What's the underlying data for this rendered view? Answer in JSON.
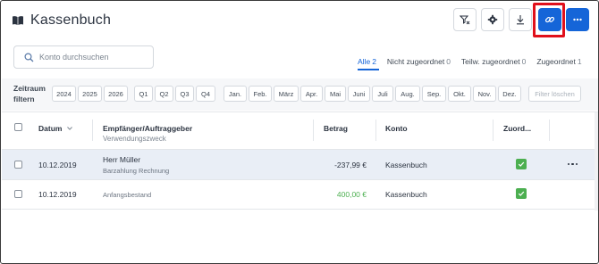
{
  "header": {
    "title": "Kassenbuch"
  },
  "toolbar": {
    "icons": [
      "filter-clear-icon",
      "settings-icon",
      "download-icon",
      "link-icon",
      "more-icon"
    ],
    "accent_color": "#1565d8",
    "highlight_color": "#e0101b"
  },
  "search": {
    "placeholder": "Konto durchsuchen",
    "value": ""
  },
  "tabs": [
    {
      "label": "Alle",
      "count": "2",
      "active": true
    },
    {
      "label": "Nicht zugeordnet",
      "count": "0",
      "active": false
    },
    {
      "label": "Teilw. zugeordnet",
      "count": "0",
      "active": false
    },
    {
      "label": "Zugeordnet",
      "count": "1",
      "active": false
    }
  ],
  "filter": {
    "label_line1": "Zeitraum",
    "label_line2": "filtern",
    "years": [
      "2024",
      "2025",
      "2026"
    ],
    "quarters": [
      "Q1",
      "Q2",
      "Q3",
      "Q4"
    ],
    "months": [
      "Jan.",
      "Feb.",
      "März",
      "Apr.",
      "Mai",
      "Juni",
      "Juli",
      "Aug.",
      "Sep.",
      "Okt.",
      "Nov.",
      "Dez."
    ],
    "clear_label": "Filter löschen"
  },
  "table": {
    "headers": {
      "date": "Datum",
      "payee": "Empfänger/Auftraggeber",
      "purpose": "Verwendungszweck",
      "amount": "Betrag",
      "account": "Konto",
      "assign": "Zuord..."
    },
    "rows": [
      {
        "date": "10.12.2019",
        "payee": "Herr Müller",
        "purpose": "Barzahlung Rechnung",
        "amount": "-237,99 €",
        "amount_color": "#2b3340",
        "account": "Kassenbuch",
        "assigned": true,
        "selected": true
      },
      {
        "date": "10.12.2019",
        "payee": "",
        "purpose": "Anfangsbestand",
        "amount": "400,00 €",
        "amount_color": "#4caf50",
        "account": "Kassenbuch",
        "assigned": true,
        "selected": false
      }
    ]
  }
}
